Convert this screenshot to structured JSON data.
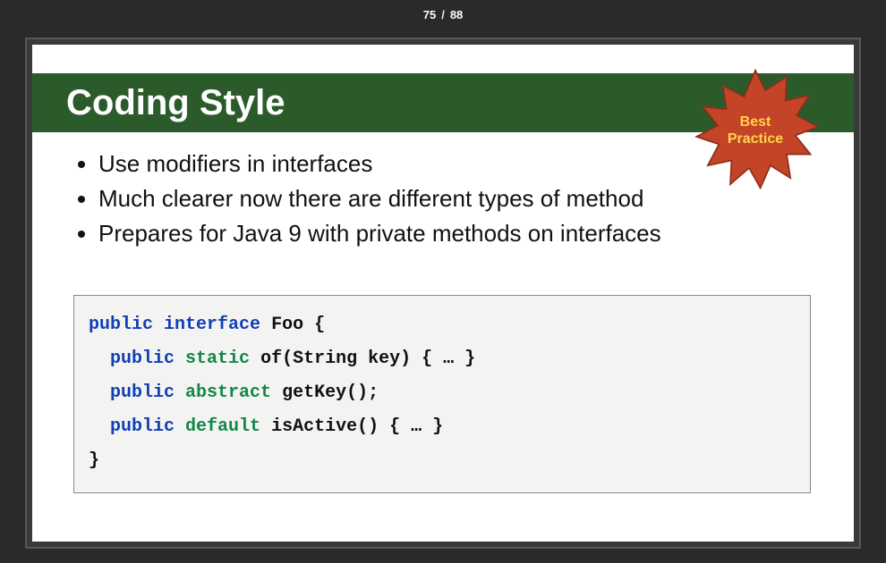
{
  "pager": {
    "current": "75",
    "sep": "/",
    "total": "88"
  },
  "slide": {
    "title": "Coding Style",
    "badge": "Best\nPractice",
    "bullets": [
      "Use modifiers in interfaces",
      "Much clearer now there are different types of method",
      "Prepares for Java 9 with private methods on interfaces"
    ],
    "code": {
      "lines": [
        {
          "tokens": [
            {
              "t": "public",
              "c": "kw-public"
            },
            {
              "t": " "
            },
            {
              "t": "interface",
              "c": "kw-public"
            },
            {
              "t": " Foo {"
            }
          ]
        },
        {
          "tokens": [
            {
              "t": "  "
            },
            {
              "t": "public",
              "c": "kw-public"
            },
            {
              "t": " "
            },
            {
              "t": "static",
              "c": "kw-mod"
            },
            {
              "t": " of(String key) { … }"
            }
          ]
        },
        {
          "tokens": [
            {
              "t": "  "
            },
            {
              "t": "public",
              "c": "kw-public"
            },
            {
              "t": " "
            },
            {
              "t": "abstract",
              "c": "kw-mod"
            },
            {
              "t": " getKey();"
            }
          ]
        },
        {
          "tokens": [
            {
              "t": "  "
            },
            {
              "t": "public",
              "c": "kw-public"
            },
            {
              "t": " "
            },
            {
              "t": "default",
              "c": "kw-mod"
            },
            {
              "t": " isActive() { … }"
            }
          ]
        },
        {
          "tokens": [
            {
              "t": "}"
            }
          ]
        }
      ]
    }
  }
}
